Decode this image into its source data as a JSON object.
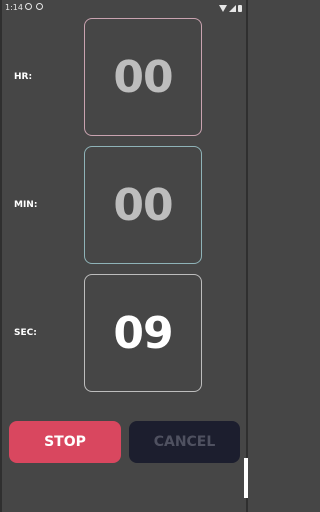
{
  "status_bar": {
    "time": "1:14"
  },
  "timer": {
    "hours_label": "HR:",
    "hours_value": "00",
    "minutes_label": "MIN:",
    "minutes_value": "00",
    "seconds_label": "SEC:",
    "seconds_value": "09"
  },
  "actions": {
    "stop_label": "STOP",
    "cancel_label": "CANCEL"
  },
  "colors": {
    "background": "#464646",
    "stop_button": "#d9475f",
    "cancel_button": "#1c1e2e",
    "hr_border": "#c9a3b0",
    "min_border": "#8fb3b8"
  }
}
